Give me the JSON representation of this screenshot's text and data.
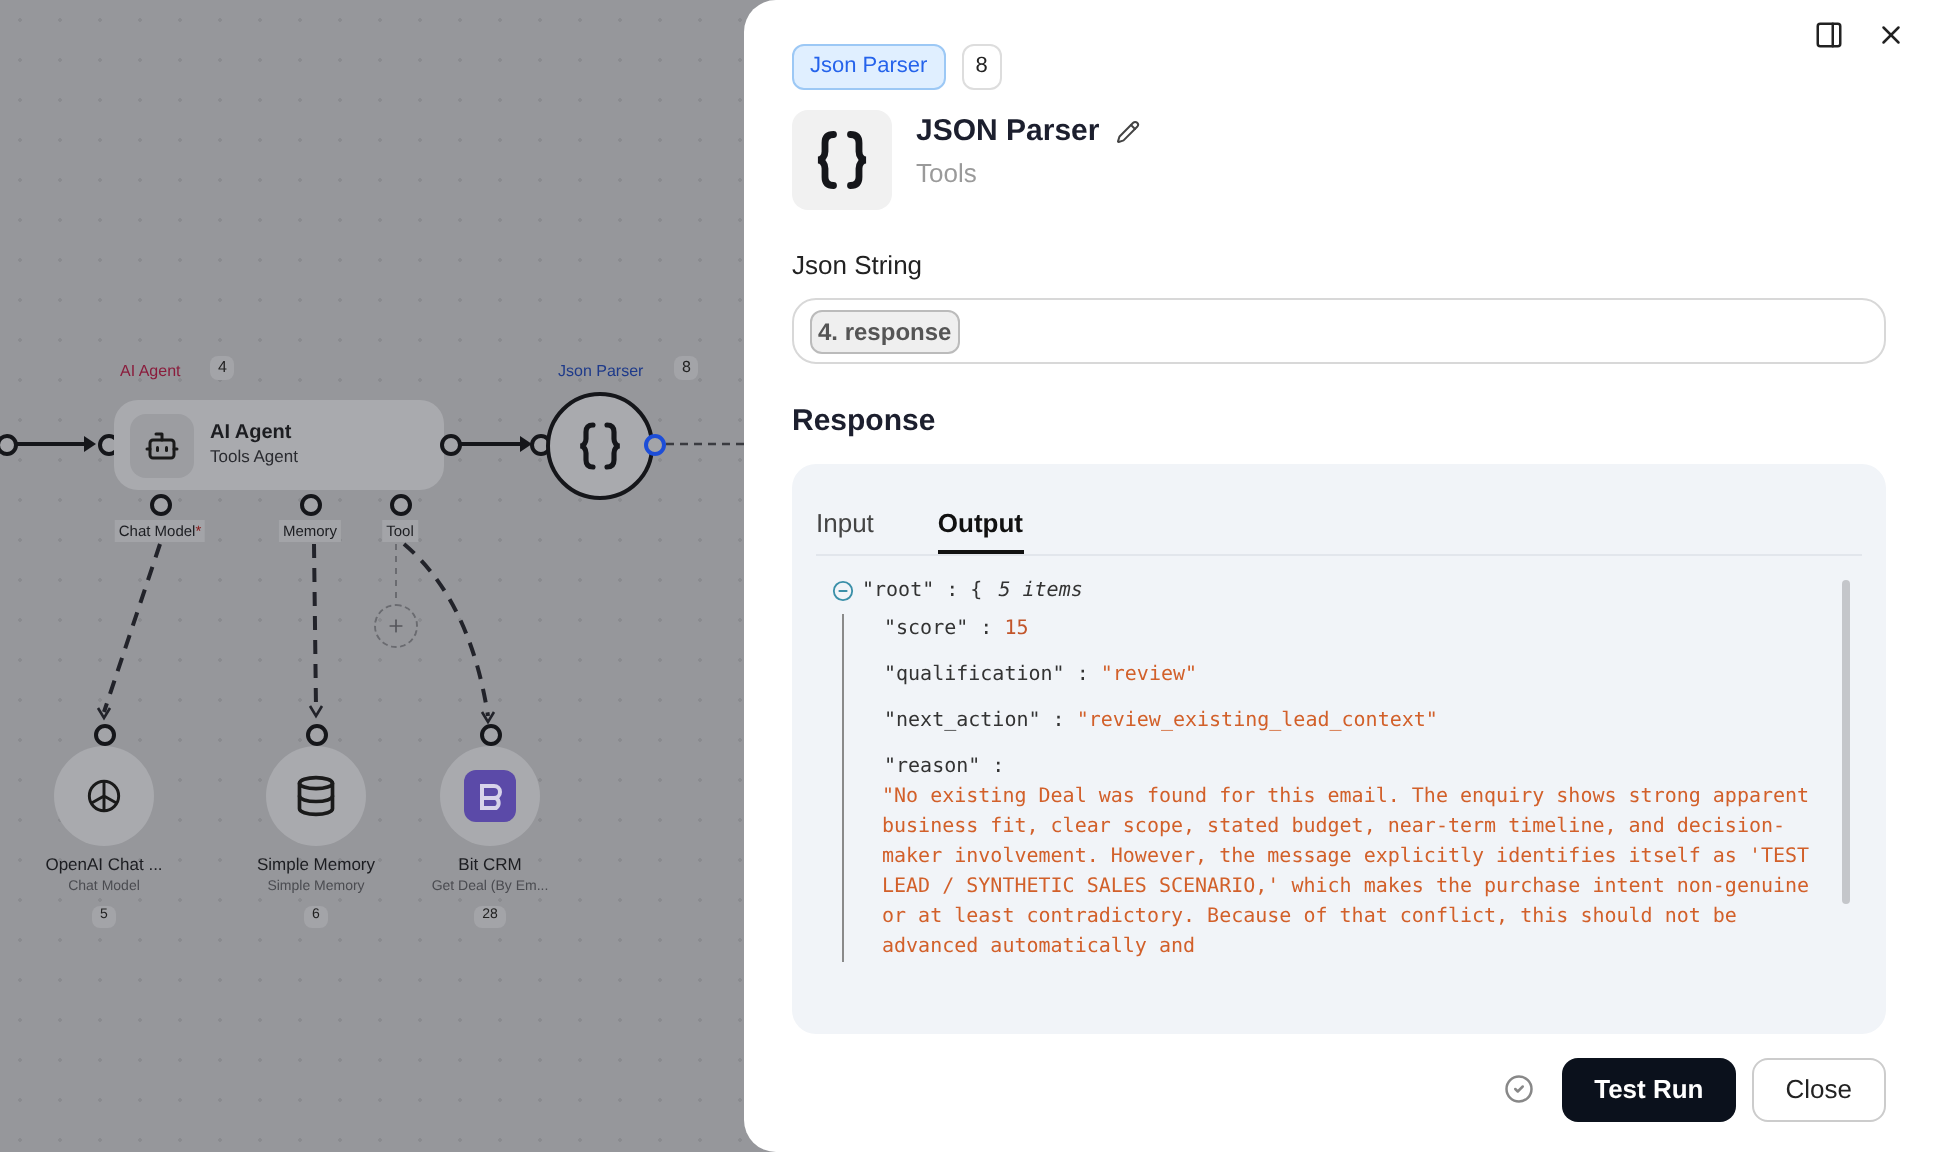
{
  "canvas": {
    "agent": {
      "badge": "AI Agent",
      "count": "4",
      "title": "AI Agent",
      "subtitle": "Tools Agent"
    },
    "ports": [
      {
        "label": "Chat Model",
        "mark": "*"
      },
      {
        "label": "Memory"
      },
      {
        "label": "Tool"
      }
    ],
    "parser": {
      "badge": "Json Parser",
      "count": "8"
    },
    "sub_nodes": [
      {
        "kind": "openai",
        "title": "OpenAI Chat ...",
        "subtitle": "Chat Model",
        "count": "5"
      },
      {
        "kind": "memory",
        "title": "Simple Memory",
        "subtitle": "Simple Memory",
        "count": "6"
      },
      {
        "kind": "crm",
        "title": "Bit CRM",
        "subtitle": "Get Deal (By Em...",
        "count": "28"
      }
    ]
  },
  "panel": {
    "tag": "Json Parser",
    "count": "8",
    "title": "JSON Parser",
    "subtitle": "Tools",
    "field": {
      "label": "Json String",
      "chip": "4. response"
    },
    "section": "Response",
    "tabs": [
      {
        "label": "Input",
        "selected": false
      },
      {
        "label": "Output",
        "selected": true
      }
    ],
    "tree": {
      "key": "\"root\"",
      "separator": ":",
      "open": "{",
      "summary": "5 items",
      "expanded": true,
      "entries": [
        {
          "key": "\"score\"",
          "value": "15",
          "kind": "number"
        },
        {
          "key": "\"qualification\"",
          "value": "\"review\"",
          "kind": "string"
        },
        {
          "key": "\"next_action\"",
          "value": "\"review_existing_lead_context\"",
          "kind": "string"
        },
        {
          "key": "\"reason\"",
          "value": "\"No existing Deal was found for this email. The enquiry shows strong apparent business fit, clear scope, stated budget, near-term timeline, and decision-maker involvement. However, the message explicitly identifies itself as 'TEST LEAD / SYNTHETIC SALES SCENARIO,' which makes the purchase intent non-genuine or at least contradictory. Because of that conflict, this should not be advanced automatically and",
          "kind": "long"
        }
      ]
    },
    "buttons": [
      {
        "label": "Test Run",
        "kind": "primary"
      },
      {
        "label": "Close",
        "kind": "secondary"
      }
    ]
  }
}
